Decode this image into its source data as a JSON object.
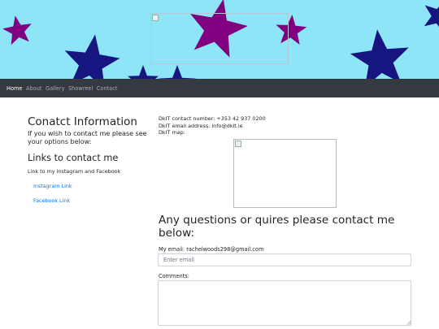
{
  "colors": {
    "banner_bg": "#8ee5f7",
    "star_purple": "#800080",
    "star_navy": "#17157f",
    "navbar_bg": "#343a40",
    "link_blue": "#007bff"
  },
  "banner": {
    "image_icon": "broken-image-icon"
  },
  "nav": {
    "items": [
      {
        "label": "Home",
        "active": true
      },
      {
        "label": "About",
        "active": false
      },
      {
        "label": "Gallery",
        "active": false
      },
      {
        "label": "Showreel",
        "active": false
      },
      {
        "label": "Contact",
        "active": false
      }
    ]
  },
  "contact_info": {
    "heading": "Conatct Information",
    "intro": "If you wish to contact me please see your options below:"
  },
  "links_section": {
    "heading": "Links to contact me",
    "subtext": "Link to my Instagram and Facebook",
    "instagram_label": "Instagram Link",
    "facebook_label": "Facebook Link"
  },
  "details": {
    "phone": "DkIT contact number: +353 42 937 0200",
    "email": "DkIT email address: info@dkit.ie",
    "map_label": "DkIT map:",
    "map_icon": "broken-image-icon"
  },
  "form": {
    "heading": "Any questions or quires please contact me below:",
    "email_label": "My email: rachelwoods298@gmail.com",
    "email_placeholder": "Enter email",
    "comments_label": "Comments:"
  }
}
